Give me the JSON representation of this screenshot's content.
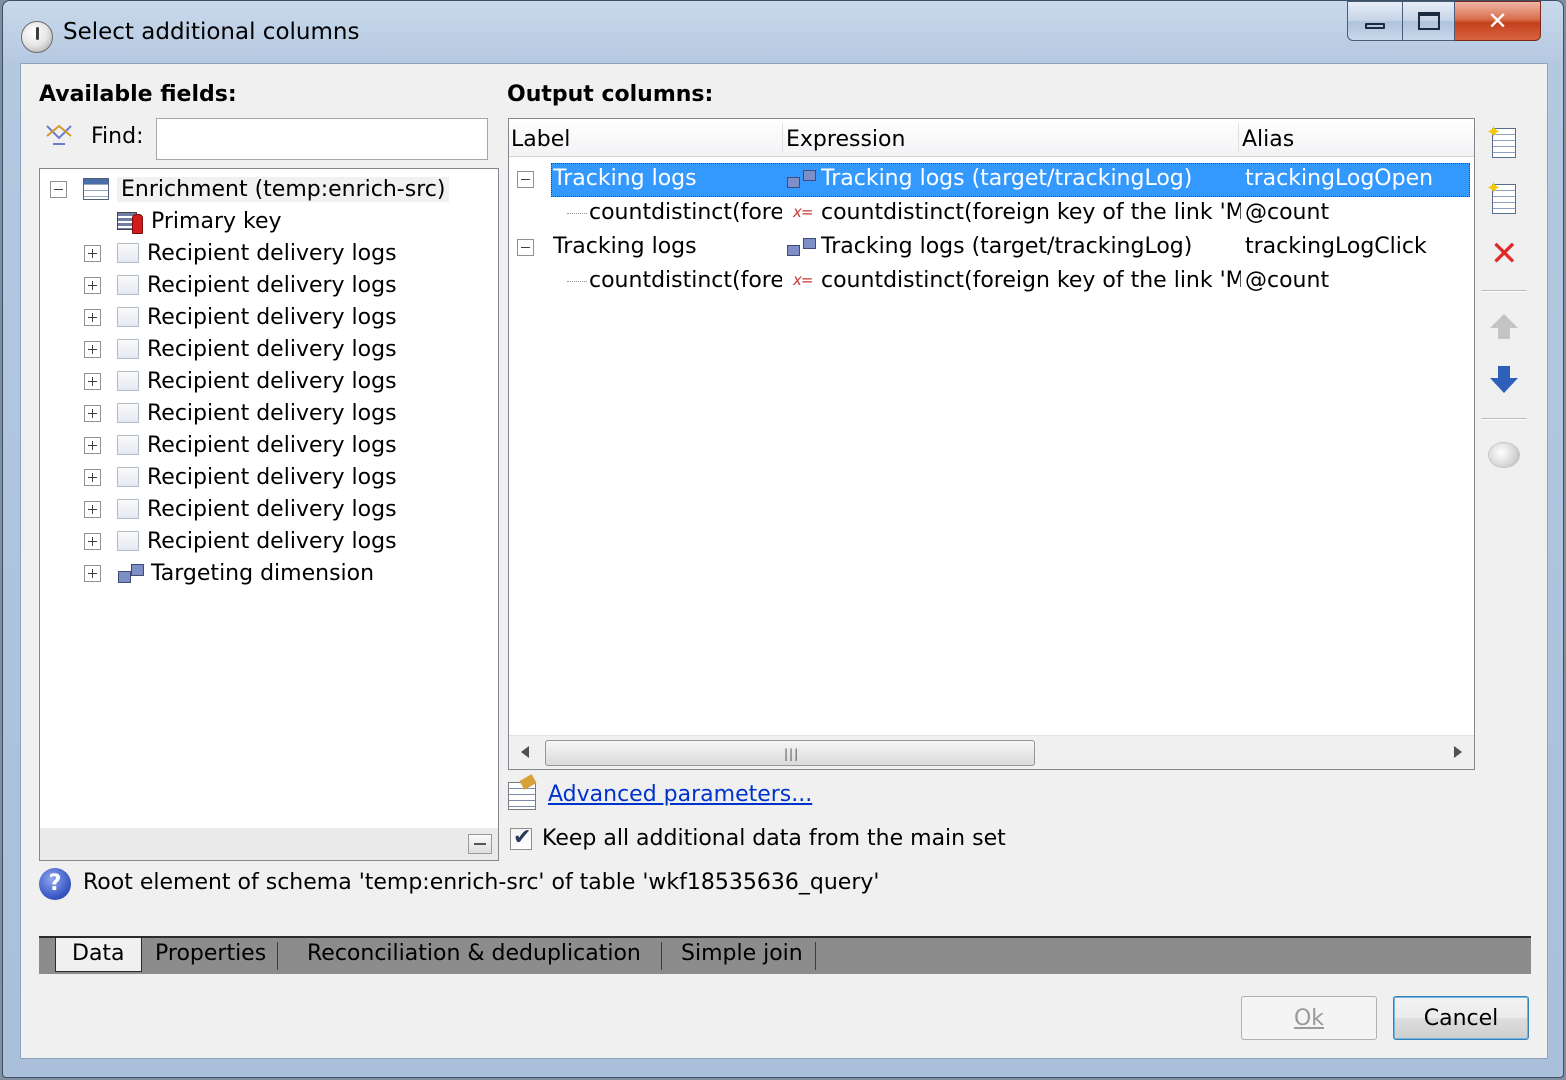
{
  "window": {
    "title": "Select additional columns"
  },
  "available_fields": {
    "heading": "Available fields:",
    "find_label": "Find:",
    "find_value": "",
    "tree": [
      {
        "label": "Enrichment (temp:enrich-src)",
        "icon": "table-icon",
        "expander": "minus",
        "level": 0
      },
      {
        "label": "Primary key",
        "icon": "primary-key-icon",
        "expander": "none",
        "level": 1
      },
      {
        "label": "Recipient delivery logs",
        "icon": "element-icon",
        "expander": "plus",
        "level": 1
      },
      {
        "label": "Recipient delivery logs",
        "icon": "element-icon",
        "expander": "plus",
        "level": 1
      },
      {
        "label": "Recipient delivery logs",
        "icon": "element-icon",
        "expander": "plus",
        "level": 1
      },
      {
        "label": "Recipient delivery logs",
        "icon": "element-icon",
        "expander": "plus",
        "level": 1
      },
      {
        "label": "Recipient delivery logs",
        "icon": "element-icon",
        "expander": "plus",
        "level": 1
      },
      {
        "label": "Recipient delivery logs",
        "icon": "element-icon",
        "expander": "plus",
        "level": 1
      },
      {
        "label": "Recipient delivery logs",
        "icon": "element-icon",
        "expander": "plus",
        "level": 1
      },
      {
        "label": "Recipient delivery logs",
        "icon": "element-icon",
        "expander": "plus",
        "level": 1
      },
      {
        "label": "Recipient delivery logs",
        "icon": "element-icon",
        "expander": "plus",
        "level": 1
      },
      {
        "label": "Recipient delivery logs",
        "icon": "element-icon",
        "expander": "plus",
        "level": 1
      },
      {
        "label": "Targeting dimension",
        "icon": "link-icon",
        "expander": "plus",
        "level": 1
      }
    ]
  },
  "output_columns": {
    "heading": "Output columns:",
    "columns": [
      "Label",
      "Expression",
      "Alias"
    ],
    "rows": [
      {
        "label": "Tracking logs",
        "expression": "Tracking logs (target/trackingLog)",
        "alias": "trackingLogOpen",
        "icon": "link-icon",
        "expander": "minus",
        "selected": true
      },
      {
        "label": "countdistinct(foreign key of the link 'Message' (@broadLog-id))",
        "expression": "countdistinct(foreign key of the link 'Message' (@broadLog-id))",
        "alias": "@count",
        "icon": "expression-icon",
        "expander": "none",
        "selected": false
      },
      {
        "label": "Tracking logs",
        "expression": "Tracking logs (target/trackingLog)",
        "alias": "trackingLogClick",
        "icon": "link-icon",
        "expander": "minus",
        "selected": false
      },
      {
        "label": "countdistinct(foreign key of the link 'Message' (@broadLog-id))",
        "expression": "countdistinct(foreign key of the link 'Message' (@broadLog-id))",
        "alias": "@count",
        "icon": "expression-icon",
        "expander": "none",
        "selected": false
      }
    ]
  },
  "advanced_link": "Advanced parameters...",
  "keep_all": {
    "label": "Keep all additional data from the main set",
    "checked": true
  },
  "status": "Root element of schema 'temp:enrich-src' of table 'wkf18535636_query'",
  "tabs": [
    {
      "label": "Data",
      "active": true
    },
    {
      "label": "Properties",
      "active": false
    },
    {
      "label": "Reconciliation & deduplication",
      "active": false
    },
    {
      "label": "Simple join",
      "active": false
    }
  ],
  "buttons": {
    "ok": "Ok",
    "cancel": "Cancel"
  }
}
